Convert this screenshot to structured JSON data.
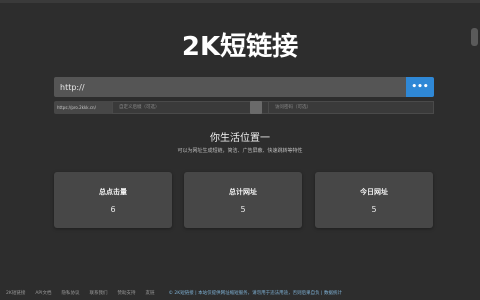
{
  "header": {
    "title": "2K短链接"
  },
  "shortener": {
    "url_value": "http://",
    "submit_label": "•••",
    "domain_option": "https://pro.2kkk.cn/",
    "alias_placeholder": "自定义后缀（可选）",
    "password_placeholder": "访问密码（可选）"
  },
  "intro": {
    "title": "你生活位置一",
    "subtitle": "可以为网址生成短链，简洁、广告屏蔽、快速跳转等特性"
  },
  "stats": [
    {
      "label": "总点击量",
      "value": "6"
    },
    {
      "label": "总计网址",
      "value": "5"
    },
    {
      "label": "今日网址",
      "value": "5"
    }
  ],
  "footer": {
    "links": [
      "2K短链接",
      "API文档",
      "隐私协议",
      "联系我们",
      "赞助支持",
      "友链"
    ],
    "notice": "© 2K短链接 | 本站仅提供网址缩短服务，请勿用于违法用途，否则后果自负 | 数据统计"
  }
}
